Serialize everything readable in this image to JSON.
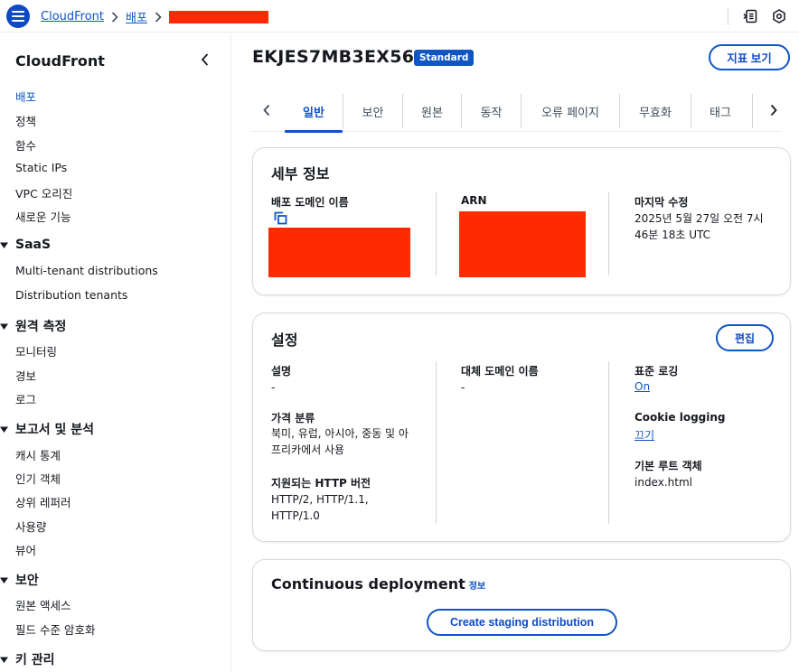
{
  "breadcrumb": {
    "service": "CloudFront",
    "section": "배포"
  },
  "sidebar": {
    "title": "CloudFront",
    "top_items": [
      "배포",
      "정책",
      "함수",
      "Static IPs",
      "VPC 오리진",
      "새로운 기능"
    ],
    "sections": [
      {
        "label": "SaaS",
        "items": [
          "Multi-tenant distributions",
          "Distribution tenants"
        ]
      },
      {
        "label": "원격 측정",
        "items": [
          "모니터링",
          "경보",
          "로그"
        ]
      },
      {
        "label": "보고서 및 분석",
        "items": [
          "캐시 통계",
          "인기 객체",
          "상위 레퍼러",
          "사용량",
          "뷰어"
        ]
      },
      {
        "label": "보안",
        "items": [
          "원본 액세스",
          "필드 수준 암호화"
        ]
      },
      {
        "label": "키 관리",
        "items": []
      }
    ]
  },
  "page": {
    "title": "EKJES7MB3EX56",
    "badge": "Standard",
    "metrics_button": "지표 보기"
  },
  "tabs": [
    "일반",
    "보안",
    "원본",
    "동작",
    "오류 페이지",
    "무효화",
    "태그"
  ],
  "details": {
    "title": "세부 정보",
    "domain_label": "배포 도메인 이름",
    "arn_label": "ARN",
    "modified_label": "마지막 수정",
    "modified_value": "2025년 5월 27일 오전 7시 46분 18초 UTC"
  },
  "settings": {
    "title": "설정",
    "edit_button": "편집",
    "description_label": "설명",
    "description_value": "-",
    "price_label": "가격 분류",
    "price_value": "북미, 유럽, 아시아, 중동 및 아프리카에서 사용",
    "http_label": "지원되는 HTTP 버전",
    "http_value": "HTTP/2, HTTP/1.1, HTTP/1.0",
    "alt_domain_label": "대체 도메인 이름",
    "alt_domain_value": "-",
    "std_logging_label": "표준 로깅",
    "std_logging_value": "On",
    "cookie_logging_label": "Cookie logging",
    "cookie_logging_value": "끄기",
    "root_object_label": "기본 루트 객체",
    "root_object_value": "index.html"
  },
  "continuous": {
    "title": "Continuous deployment",
    "info": "정보",
    "button": "Create staging distribution"
  },
  "colors": {
    "accent": "#0f55c4",
    "redaction": "#ff2a00"
  },
  "icons": [
    "menu-icon",
    "chevron-right-icon",
    "copy-icon",
    "chevron-left-icon",
    "caret-down-icon"
  ]
}
